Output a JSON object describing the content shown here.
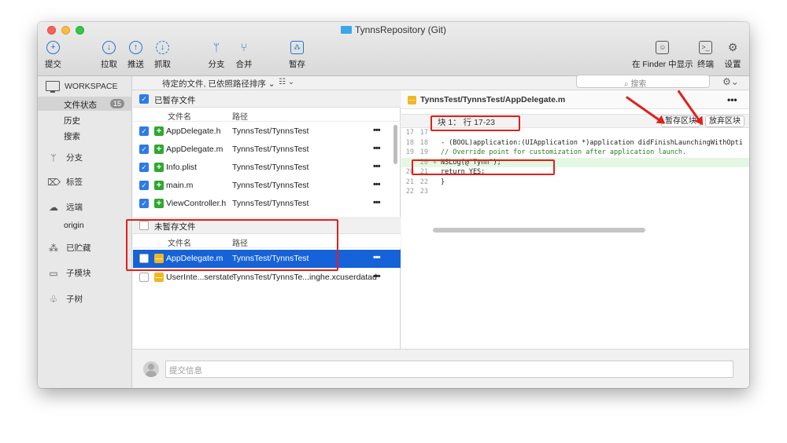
{
  "window": {
    "title": "TynnsRepository (Git)"
  },
  "toolbar": {
    "commit": "提交",
    "pull": "拉取",
    "push": "推送",
    "fetch": "抓取",
    "branch": "分支",
    "merge": "合并",
    "stash": "暂存",
    "show_in_finder": "在 Finder 中显示",
    "terminal": "终端",
    "settings": "设置"
  },
  "sidebar": {
    "workspace": "WORKSPACE",
    "file_status": "文件状态",
    "file_status_count": "15",
    "history": "历史",
    "search": "搜索",
    "branches": "分支",
    "tags": "标签",
    "remotes": "远端",
    "origin": "origin",
    "stashes": "已贮藏",
    "submodules": "子模块",
    "subtrees": "子树"
  },
  "strip": {
    "sort": "待定的文件, 已依照路径排序 ⌄",
    "view": "☷ ⌄",
    "search_placeholder": "搜索"
  },
  "staged": {
    "title": "已暂存文件",
    "col_name": "文件名",
    "col_path": "路径",
    "files": [
      {
        "name": "AppDelegate.h",
        "path": "TynnsTest/TynnsTest"
      },
      {
        "name": "AppDelegate.m",
        "path": "TynnsTest/TynnsTest"
      },
      {
        "name": "Info.plist",
        "path": "TynnsTest/TynnsTest"
      },
      {
        "name": "main.m",
        "path": "TynnsTest/TynnsTest"
      },
      {
        "name": "ViewController.h",
        "path": "TynnsTest/TynnsTest"
      }
    ]
  },
  "unstaged": {
    "title": "未暂存文件",
    "col_name": "文件名",
    "col_path": "路径",
    "files": [
      {
        "name": "AppDelegate.m",
        "path": "TynnsTest/TynnsTest"
      },
      {
        "name": "UserInte...serstate",
        "path": "TynnsTest/TynnsTe...inghe.xcuserdatad"
      }
    ]
  },
  "diff": {
    "file_path": "TynnsTest/TynnsTest/AppDelegate.m",
    "hunk_title": "块 1： 行 17-23",
    "stage_hunk": "暂存区块",
    "discard_hunk": "放弃区块",
    "lines": [
      {
        "old": "17",
        "new": "17",
        "mark": "",
        "text": ""
      },
      {
        "old": "18",
        "new": "18",
        "mark": "",
        "text": "- (BOOL)application:(UIApplication *)application didFinishLaunchingWithOpti"
      },
      {
        "old": "19",
        "new": "19",
        "mark": "",
        "text": "    // Override point for customization after application launch."
      },
      {
        "old": "",
        "new": "20",
        "mark": "+",
        "text": "    NSLog(@\"Tynn\");"
      },
      {
        "old": "20",
        "new": "21",
        "mark": "",
        "text": "    return YES;"
      },
      {
        "old": "21",
        "new": "22",
        "mark": "",
        "text": "}"
      },
      {
        "old": "22",
        "new": "23",
        "mark": "",
        "text": ""
      }
    ]
  },
  "commit": {
    "placeholder": "提交信息"
  },
  "colors": {
    "accent": "#1662d8",
    "annotation": "#e0201c",
    "added": "#2fa82f",
    "modified": "#f3b61f"
  }
}
